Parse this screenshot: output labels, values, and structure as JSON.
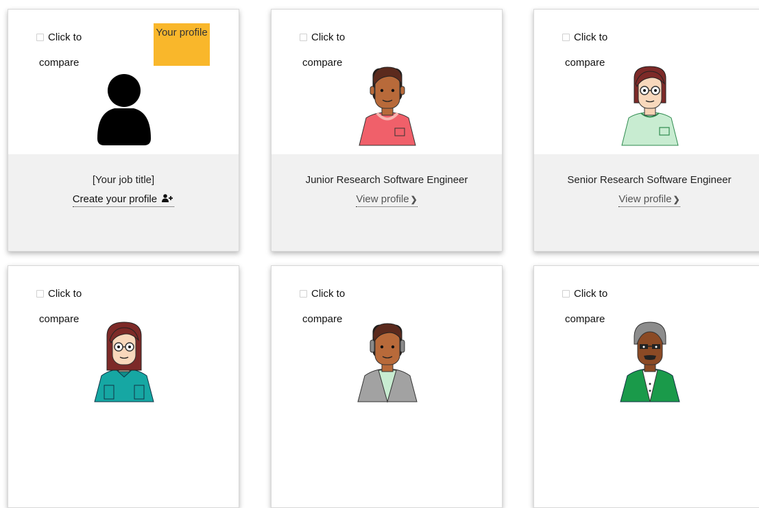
{
  "compare": {
    "line1": "Click to",
    "line2": "compare"
  },
  "badge": {
    "label": "Your profile"
  },
  "cards": [
    {
      "title": "[Your job title]",
      "link": "Create your profile",
      "link_icon": "add-user-icon"
    },
    {
      "title": "Junior Research Software Engineer",
      "link": "View profile",
      "link_icon": "chevron-right-icon"
    },
    {
      "title": "Senior Research Software Engineer",
      "link": "View profile",
      "link_icon": "chevron-right-icon"
    }
  ],
  "colors": {
    "badge": "#f9b72b",
    "card_footer": "#f1f1f1",
    "shirt_red": "#f0606a",
    "shirt_mint": "#c8ecd1",
    "shirt_teal": "#16a7a3",
    "shirt_grey": "#a2a2a2",
    "shirt_green": "#1a9a4a"
  }
}
